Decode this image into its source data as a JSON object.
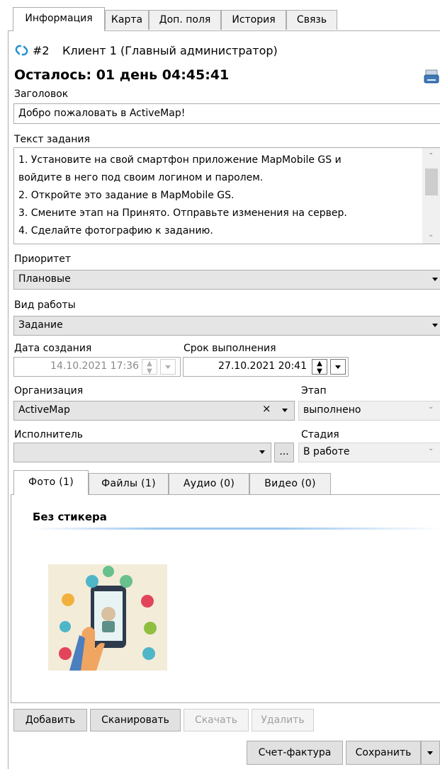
{
  "tabs": [
    "Информация",
    "Карта",
    "Доп. поля",
    "История",
    "Связь"
  ],
  "header": {
    "number": "#2",
    "client": "Клиент 1 (Главный администратор)",
    "remaining": "Осталось: 01 день 04:45:41"
  },
  "title_field": {
    "label": "Заголовок",
    "value": "Добро пожаловать в ActiveMap!"
  },
  "task_text": {
    "label": "Текст задания",
    "lines": [
      "1. Установите на свой смартфон приложение MapMobile GS и",
      "войдите в него под своим логином и паролем.",
      "2. Откройте это задание в MapMobile GS.",
      "3. Смените этап на Принято. Отправьте изменения на сервер.",
      "4. Сделайте фотографию к заданию."
    ]
  },
  "priority": {
    "label": "Приоритет",
    "value": "Плановые"
  },
  "work_type": {
    "label": "Вид работы",
    "value": "Задание"
  },
  "created": {
    "label": "Дата создания",
    "value": "14.10.2021 17:36"
  },
  "deadline": {
    "label": "Срок выполнения",
    "value": "27.10.2021 20:41"
  },
  "organization": {
    "label": "Организация",
    "value": "ActiveMap",
    "clear": "×"
  },
  "stage": {
    "label": "Этап",
    "value": "выполнено"
  },
  "executor": {
    "label": "Исполнитель",
    "value": "",
    "more": "..."
  },
  "phase": {
    "label": "Стадия",
    "value": "В работе"
  },
  "media_tabs": [
    "Фото (1)",
    "Файлы (1)",
    "Аудио (0)",
    "Видео (0)"
  ],
  "sticker_group": "Без стикера",
  "media_buttons": {
    "add": "Добавить",
    "scan": "Сканировать",
    "download": "Скачать",
    "delete": "Удалить"
  },
  "footer": {
    "invoice": "Счет-фактура",
    "save": "Сохранить"
  },
  "colors": {
    "accent": "#1e90d6",
    "disabled": "#a0a0a0"
  }
}
